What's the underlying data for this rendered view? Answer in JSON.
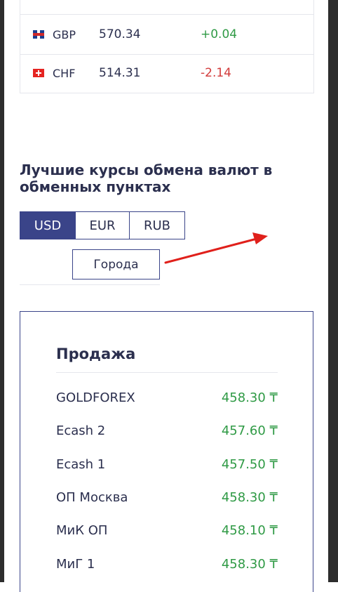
{
  "rates": [
    {
      "code": "GBP",
      "rate": "570.34",
      "change": "+0.04",
      "flag": "gb-flag-icon",
      "trend": "up"
    },
    {
      "code": "CHF",
      "rate": "514.31",
      "change": "-2.14",
      "flag": "ch-flag-icon",
      "trend": "down"
    }
  ],
  "best": {
    "title": "Лучшие курсы обмена валют в обменных пунктах",
    "tabs": [
      {
        "label": "USD",
        "active": true
      },
      {
        "label": "EUR",
        "active": false
      },
      {
        "label": "RUB",
        "active": false
      }
    ],
    "cities_label": "Города"
  },
  "sell": {
    "title": "Продажа",
    "rows": [
      {
        "name": "GOLDFOREX",
        "rate": "458.30 ₸"
      },
      {
        "name": "Ecash 2",
        "rate": "457.60 ₸"
      },
      {
        "name": "Ecash 1",
        "rate": "457.50 ₸"
      },
      {
        "name": "ОП Москва",
        "rate": "458.30 ₸"
      },
      {
        "name": "МиК ОП",
        "rate": "458.10 ₸"
      },
      {
        "name": "МиГ 1",
        "rate": "458.30 ₸"
      }
    ]
  },
  "colors": {
    "accent": "#3a4489",
    "positive": "#2f9a45",
    "negative": "#d23a3a",
    "annotation": "#e0201b"
  }
}
